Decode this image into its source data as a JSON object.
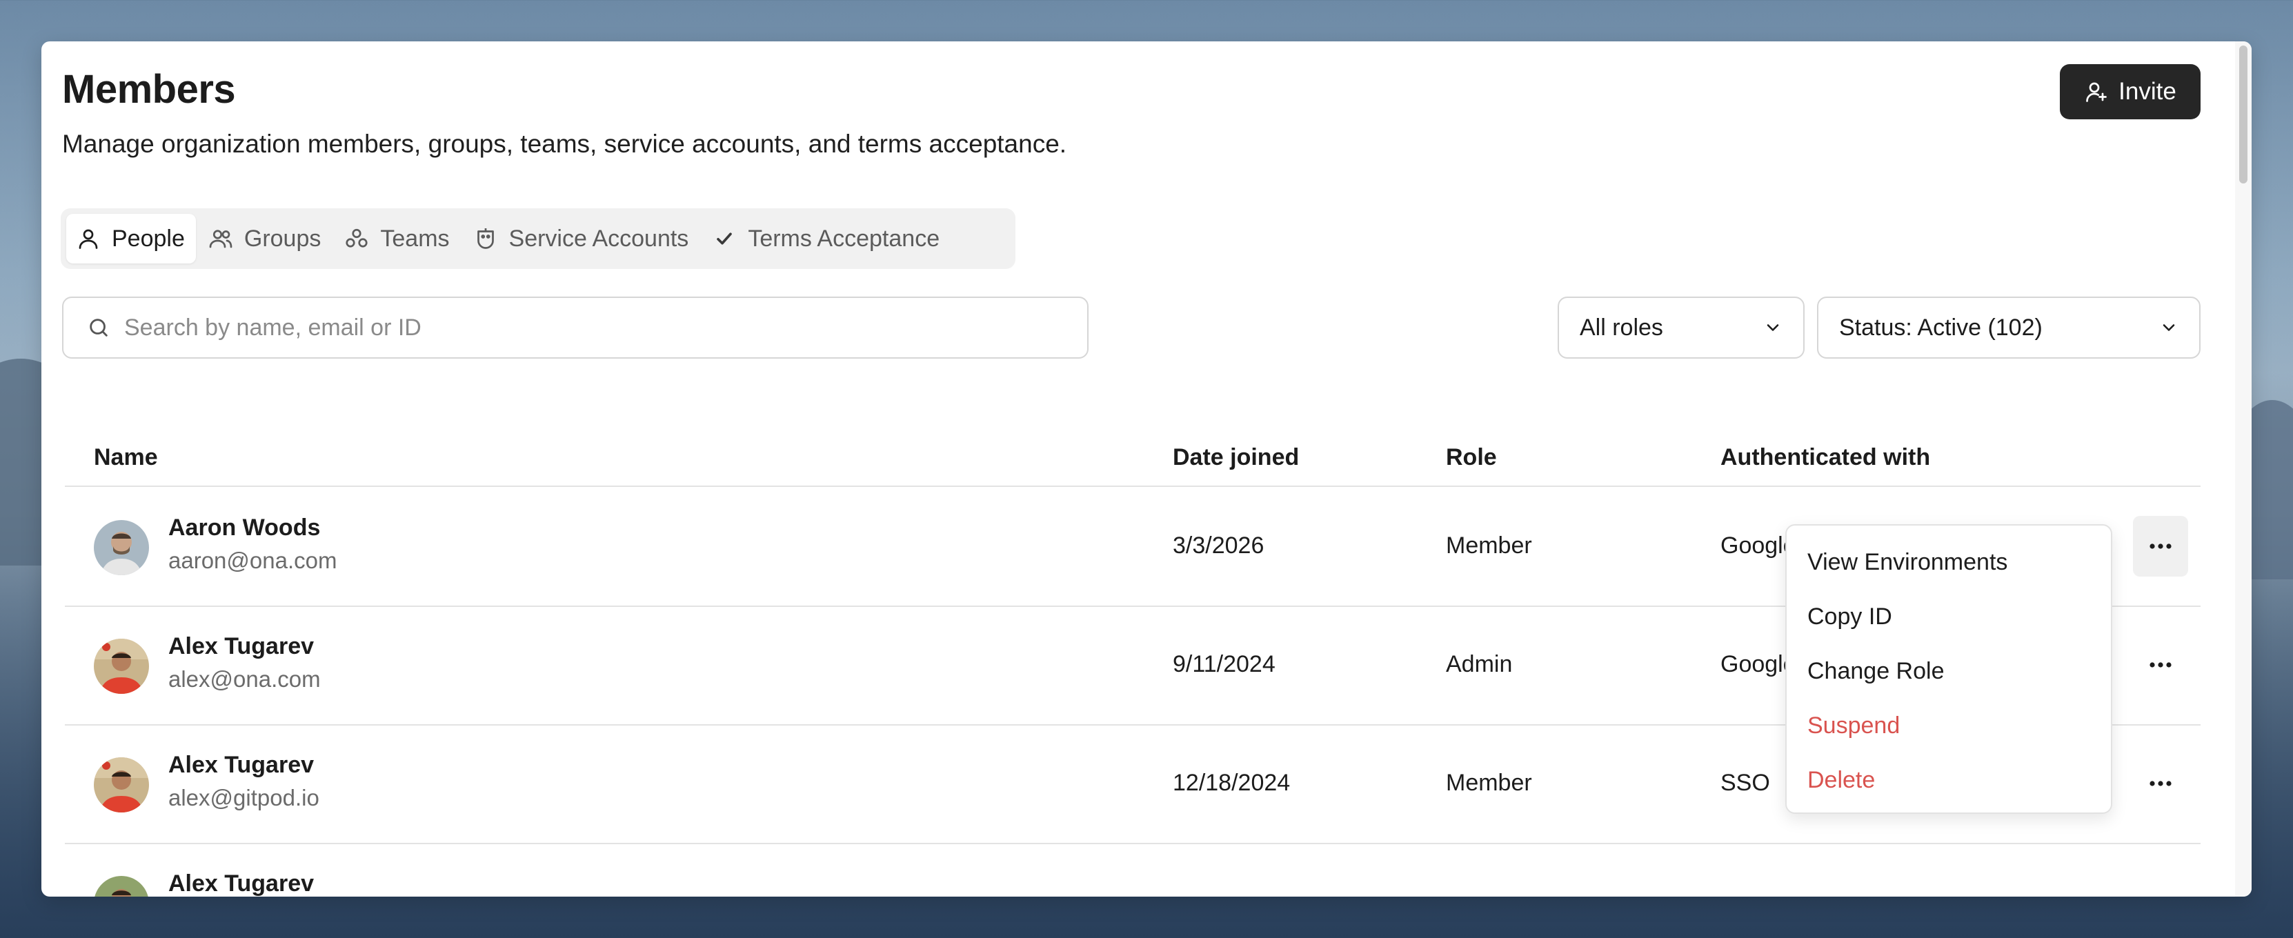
{
  "header": {
    "title": "Members",
    "subtitle": "Manage organization members, groups, teams, service accounts, and terms acceptance.",
    "invite_label": "Invite"
  },
  "tabs": [
    {
      "label": "People",
      "icon": "person-icon",
      "active": true
    },
    {
      "label": "Groups",
      "icon": "users-icon",
      "active": false
    },
    {
      "label": "Teams",
      "icon": "teams-icon",
      "active": false
    },
    {
      "label": "Service Accounts",
      "icon": "robot-icon",
      "active": false
    },
    {
      "label": "Terms Acceptance",
      "icon": "check-icon",
      "active": false
    }
  ],
  "search": {
    "placeholder": "Search by name, email or ID",
    "value": ""
  },
  "filters": {
    "roles": "All roles",
    "status": "Status: Active (102)"
  },
  "table": {
    "columns": [
      "Name",
      "Date joined",
      "Role",
      "Authenticated with"
    ],
    "rows": [
      {
        "name": "Aaron Woods",
        "email": "aaron@ona.com",
        "date": "3/3/2026",
        "role": "Member",
        "auth": "Google"
      },
      {
        "name": "Alex Tugarev",
        "email": "alex@ona.com",
        "date": "9/11/2024",
        "role": "Admin",
        "auth": "Google"
      },
      {
        "name": "Alex Tugarev",
        "email": "alex@gitpod.io",
        "date": "12/18/2024",
        "role": "Member",
        "auth": "SSO"
      },
      {
        "name": "Alex Tugarev",
        "email": "",
        "date": "",
        "role": "",
        "auth": ""
      }
    ]
  },
  "context_menu": {
    "items": [
      {
        "label": "View Environments",
        "danger": false
      },
      {
        "label": "Copy ID",
        "danger": false
      },
      {
        "label": "Change Role",
        "danger": false
      },
      {
        "label": "Suspend",
        "danger": true
      },
      {
        "label": "Delete",
        "danger": true
      }
    ],
    "danger_color": "#d9534f"
  },
  "colors": {
    "primary_button": "#262626",
    "accent_danger": "#d9534f"
  }
}
